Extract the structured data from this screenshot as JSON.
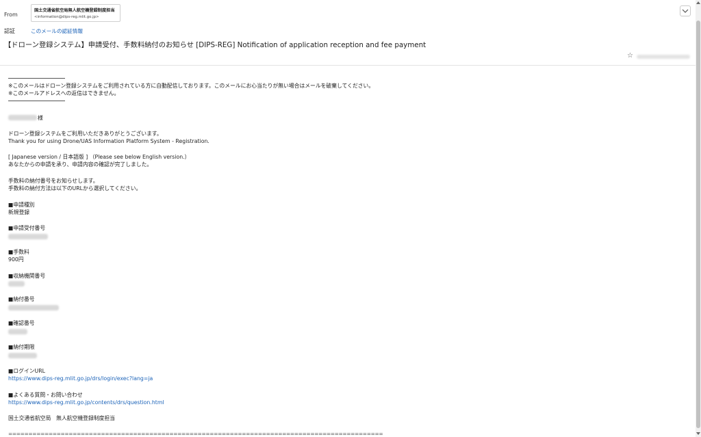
{
  "header": {
    "from_label": "From",
    "sender_name": "国土交通省航空局無人航空機登録制度担当",
    "sender_email": "<information@dips-reg.mlit.go.jp>",
    "auth_label": "認証",
    "auth_link": "このメールの認証情報",
    "subject": "【ドローン登録システム】申請受付、手数料納付のお知らせ [DIPS-REG] Notification of application reception and fee payment",
    "icons": [
      "chevron-down-icon",
      "star-icon"
    ]
  },
  "body": {
    "notice_1": "※このメールはドローン登録システムをご利用されている方に自動配信しております。このメールにお心当たりが無い場合はメールを破棄してください。",
    "notice_2": "※このメールアドレスへの返信はできません。",
    "salutation_suffix": "様",
    "thanks_ja": "ドローン登録システムをご利用いただきありがとうございます。",
    "thanks_en": "Thank you for using Drone/UAS Information Platform System - Registration.",
    "version_note": "[ Japanese version / 日本語版 ] （Please see below English version.）",
    "confirmation": "あなたからの申請を承り、申請内容の確認が完了しました。",
    "fee_notice_1": "手数料の納付番号をお知らせします。",
    "fee_notice_2": "手数料の納付方法は以下のURLから選択してください。",
    "application_type_label": "■申請種別",
    "application_type_value": "新規登録",
    "reception_number_label": "■申請受付番号",
    "fee_label": "■手数料",
    "fee_value": "900円",
    "agency_number_label": "■収納機関番号",
    "payment_number_label": "■納付番号",
    "confirmation_number_label": "■確認番号",
    "deadline_label": "■納付期限",
    "login_url_label": "■ログインURL",
    "login_url": "https://www.dips-reg.mlit.go.jp/drs/login/exec?lang=ja",
    "faq_label": "■よくある質問・お問い合わせ",
    "faq_url": "https://www.dips-reg.mlit.go.jp/contents/drs/question.html",
    "signature": "国土交通省航空局　無人航空機登録制度担当",
    "separator": "==========================================================================================================================="
  },
  "colors": {
    "link": "#1a62b8",
    "text": "#222222",
    "border": "#e3e3e3"
  }
}
